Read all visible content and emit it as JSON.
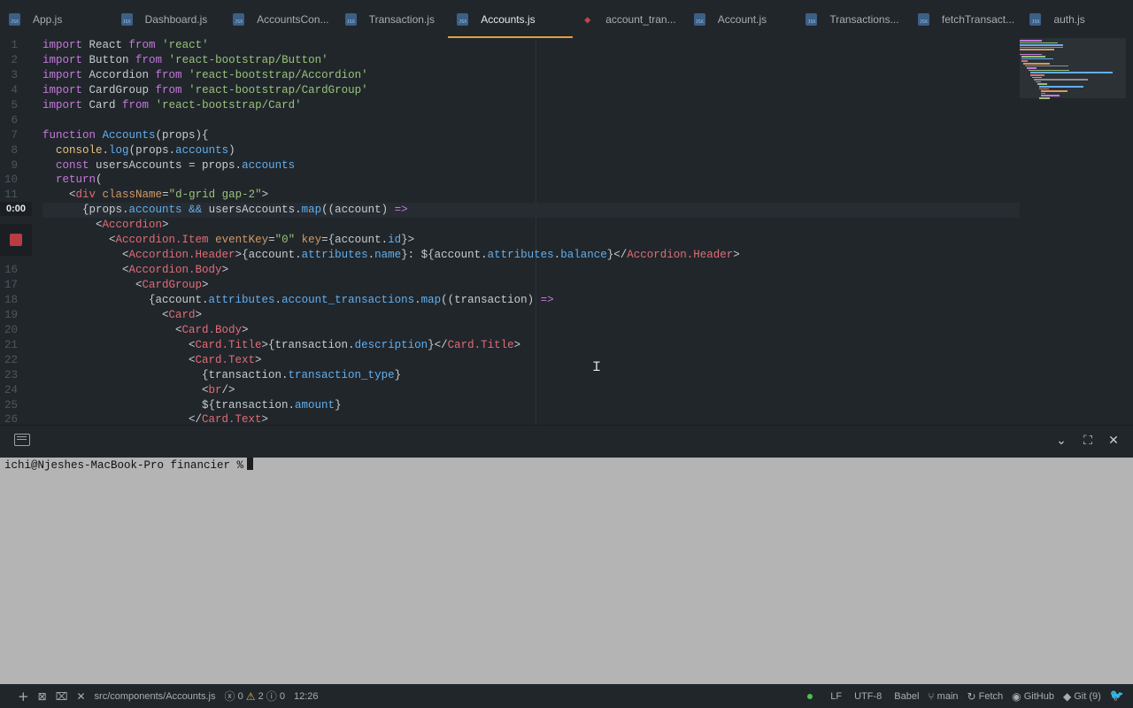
{
  "tabs": [
    {
      "label": "App.js",
      "icon": "jsx-file-icon",
      "active": false
    },
    {
      "label": "Dashboard.js",
      "icon": "jsx-file-icon",
      "active": false
    },
    {
      "label": "AccountsCon...",
      "icon": "jsx-file-icon",
      "active": false
    },
    {
      "label": "Transaction.js",
      "icon": "jsx-file-icon",
      "active": false
    },
    {
      "label": "Accounts.js",
      "icon": "jsx-file-icon",
      "active": true
    },
    {
      "label": "account_tran...",
      "icon": "ruby-file-icon",
      "active": false
    },
    {
      "label": "Account.js",
      "icon": "jsx-file-icon",
      "active": false
    },
    {
      "label": "Transactions...",
      "icon": "jsx-file-icon",
      "active": false
    },
    {
      "label": "fetchTransact...",
      "icon": "jsx-file-icon",
      "active": false
    },
    {
      "label": "auth.js",
      "icon": "jsx-file-icon",
      "active": false
    }
  ],
  "editor": {
    "line_numbers": [
      "1",
      "2",
      "3",
      "4",
      "5",
      "6",
      "7",
      "8",
      "9",
      "10",
      "11",
      "",
      "",
      "",
      "",
      "16",
      "17",
      "18",
      "19",
      "20",
      "21",
      "22",
      "23",
      "24",
      "25",
      "26"
    ],
    "lines": [
      "import React from 'react'",
      "import Button from 'react-bootstrap/Button'",
      "import Accordion from 'react-bootstrap/Accordion'",
      "import CardGroup from 'react-bootstrap/CardGroup'",
      "import Card from 'react-bootstrap/Card'",
      "",
      "function Accounts(props){",
      "  console.log(props.accounts)",
      "  const usersAccounts = props.accounts",
      "  return(",
      "    <div className=\"d-grid gap-2\">",
      "      {props.accounts && usersAccounts.map((account) =>",
      "        <Accordion>",
      "          <Accordion.Item eventKey=\"0\" key={account.id}>",
      "            <Accordion.Header>{account.attributes.name}: ${account.attributes.balance}</Accordion.Header>",
      "            <Accordion.Body>",
      "              <CardGroup>",
      "                {account.attributes.account_transactions.map((transaction) =>",
      "                  <Card>",
      "                    <Card.Body>",
      "                      <Card.Title>{transaction.description}</Card.Title>",
      "                      <Card.Text>",
      "                        {transaction.transaction_type}",
      "                        <br/>",
      "                        ${transaction.amount}",
      "                      </Card.Text>"
    ],
    "current_line_index": 11,
    "recording_time": "0:00"
  },
  "panel": {
    "icons": {
      "keyboard": "keyboard-icon",
      "collapse": "chevron-down-icon",
      "maximize": "maximize-icon",
      "close": "close-icon"
    }
  },
  "terminal": {
    "prompt": "ichi@Njeshes-MacBook-Pro financier %"
  },
  "statusbar": {
    "file_path": "src/components/Accounts.js",
    "errors": "0",
    "warnings": "2",
    "infos": "0",
    "cursor_position": "12:26",
    "line_ending": "LF",
    "encoding": "UTF-8",
    "grammar": "Babel",
    "branch": "main",
    "fetch_label": "Fetch",
    "github_label": "GitHub",
    "git_label": "Git (9)"
  }
}
